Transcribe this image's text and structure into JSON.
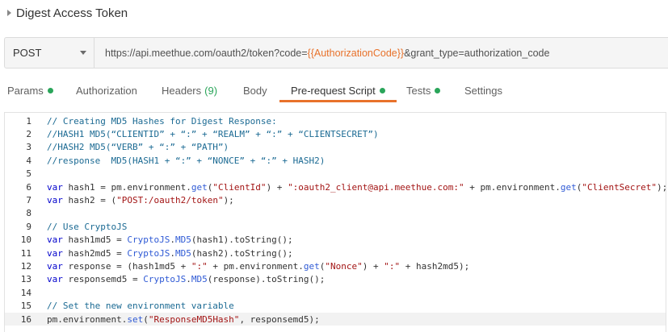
{
  "request": {
    "name": "Digest Access Token",
    "method": "POST",
    "url_parts": [
      {
        "text": "https://api.meethue.com/oauth2/token?code=",
        "kind": "plain"
      },
      {
        "text": "{{AuthorizationCode}}",
        "kind": "var"
      },
      {
        "text": "&grant_type=authorization_code",
        "kind": "plain"
      }
    ]
  },
  "tabs": [
    {
      "label": "Params",
      "dot": true,
      "count": "",
      "active": false
    },
    {
      "label": "Authorization",
      "dot": false,
      "count": "",
      "active": false
    },
    {
      "label": "Headers",
      "dot": false,
      "count": "(9)",
      "active": false
    },
    {
      "label": "Body",
      "dot": false,
      "count": "",
      "active": false
    },
    {
      "label": "Pre-request Script",
      "dot": true,
      "count": "",
      "active": true
    },
    {
      "label": "Tests",
      "dot": true,
      "count": "",
      "active": false
    },
    {
      "label": "Settings",
      "dot": false,
      "count": "",
      "active": false
    }
  ],
  "colors": {
    "accent": "#e8722b",
    "status_dot": "#2aa55a",
    "comment": "#1b6a93",
    "keyword": "#0000cc",
    "string": "#a31515",
    "method_call": "#2f5ad5"
  },
  "icons": {
    "collapse": "caret-right-icon",
    "method_dropdown": "chevron-down-icon"
  },
  "script": {
    "current_line": 16,
    "lines": [
      [
        {
          "t": "// Creating MD5 Hashes for Digest Response:",
          "c": "cm"
        }
      ],
      [
        {
          "t": "//HASH1 MD5(“CLIENTID” + “:” + “REALM” + “:” + “CLIENTSECRET”)",
          "c": "cm"
        }
      ],
      [
        {
          "t": "//HASH2 MD5(“VERB” + “:” + “PATH”)",
          "c": "cm"
        }
      ],
      [
        {
          "t": "//response  MD5(HASH1 + “:” + “NONCE” + “:” + HASH2)",
          "c": "cm"
        }
      ],
      [],
      [
        {
          "t": "var",
          "c": "kw"
        },
        {
          "t": " hash1 = pm.environment.",
          "c": ""
        },
        {
          "t": "get",
          "c": "fn"
        },
        {
          "t": "(",
          "c": ""
        },
        {
          "t": "\"ClientId\"",
          "c": "st"
        },
        {
          "t": ") + ",
          "c": ""
        },
        {
          "t": "\":oauth2_client@api.meethue.com:\"",
          "c": "st"
        },
        {
          "t": " + pm.environment.",
          "c": ""
        },
        {
          "t": "get",
          "c": "fn"
        },
        {
          "t": "(",
          "c": ""
        },
        {
          "t": "\"ClientSecret\"",
          "c": "st"
        },
        {
          "t": ");",
          "c": ""
        }
      ],
      [
        {
          "t": "var",
          "c": "kw"
        },
        {
          "t": " hash2 = (",
          "c": ""
        },
        {
          "t": "\"POST:/oauth2/token\"",
          "c": "st"
        },
        {
          "t": ");",
          "c": ""
        }
      ],
      [],
      [
        {
          "t": "// Use CryptoJS",
          "c": "cm"
        }
      ],
      [
        {
          "t": "var",
          "c": "kw"
        },
        {
          "t": " hash1md5 = ",
          "c": ""
        },
        {
          "t": "CryptoJS",
          "c": "fn"
        },
        {
          "t": ".",
          "c": ""
        },
        {
          "t": "MD5",
          "c": "fn"
        },
        {
          "t": "(hash1).toString();",
          "c": ""
        }
      ],
      [
        {
          "t": "var",
          "c": "kw"
        },
        {
          "t": " hash2md5 = ",
          "c": ""
        },
        {
          "t": "CryptoJS",
          "c": "fn"
        },
        {
          "t": ".",
          "c": ""
        },
        {
          "t": "MD5",
          "c": "fn"
        },
        {
          "t": "(hash2).toString();",
          "c": ""
        }
      ],
      [
        {
          "t": "var",
          "c": "kw"
        },
        {
          "t": " response = (hash1md5 + ",
          "c": ""
        },
        {
          "t": "\":\"",
          "c": "st"
        },
        {
          "t": " + pm.environment.",
          "c": ""
        },
        {
          "t": "get",
          "c": "fn"
        },
        {
          "t": "(",
          "c": ""
        },
        {
          "t": "\"Nonce\"",
          "c": "st"
        },
        {
          "t": ") + ",
          "c": ""
        },
        {
          "t": "\":\"",
          "c": "st"
        },
        {
          "t": " + hash2md5);",
          "c": ""
        }
      ],
      [
        {
          "t": "var",
          "c": "kw"
        },
        {
          "t": " responsemd5 = ",
          "c": ""
        },
        {
          "t": "CryptoJS",
          "c": "fn"
        },
        {
          "t": ".",
          "c": ""
        },
        {
          "t": "MD5",
          "c": "fn"
        },
        {
          "t": "(response).toString();",
          "c": ""
        }
      ],
      [],
      [
        {
          "t": "// Set the new environment variable",
          "c": "cm"
        }
      ],
      [
        {
          "t": "pm.environment.",
          "c": ""
        },
        {
          "t": "set",
          "c": "fn"
        },
        {
          "t": "(",
          "c": ""
        },
        {
          "t": "\"ResponseMD5Hash\"",
          "c": "st"
        },
        {
          "t": ", responsemd5);",
          "c": ""
        }
      ]
    ]
  }
}
